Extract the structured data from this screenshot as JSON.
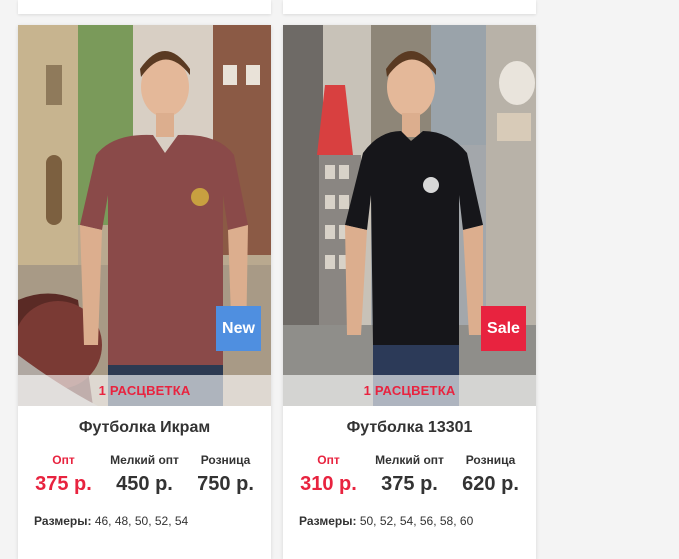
{
  "products": [
    {
      "title": "Футболка Икрам",
      "badge": "New",
      "colorways": "1 РАСЦВЕТКА",
      "prices": [
        {
          "label": "Опт",
          "value": "375 р."
        },
        {
          "label": "Мелкий опт",
          "value": "450 р."
        },
        {
          "label": "Розница",
          "value": "750 р."
        }
      ],
      "sizes_label": "Размеры:",
      "sizes": "46, 48, 50, 52, 54"
    },
    {
      "title": "Футболка 13301",
      "badge": "Sale",
      "colorways": "1 РАСЦВЕТКА",
      "prices": [
        {
          "label": "Опт",
          "value": "310 р."
        },
        {
          "label": "Мелкий опт",
          "value": "375 р."
        },
        {
          "label": "Розница",
          "value": "620 р."
        }
      ],
      "sizes_label": "Размеры:",
      "sizes": "50, 52, 54, 56, 58, 60"
    }
  ],
  "colors": {
    "accent_red": "#e8233f",
    "badge_new": "#4f8fe0",
    "badge_sale": "#e8233f",
    "text": "#333333"
  }
}
